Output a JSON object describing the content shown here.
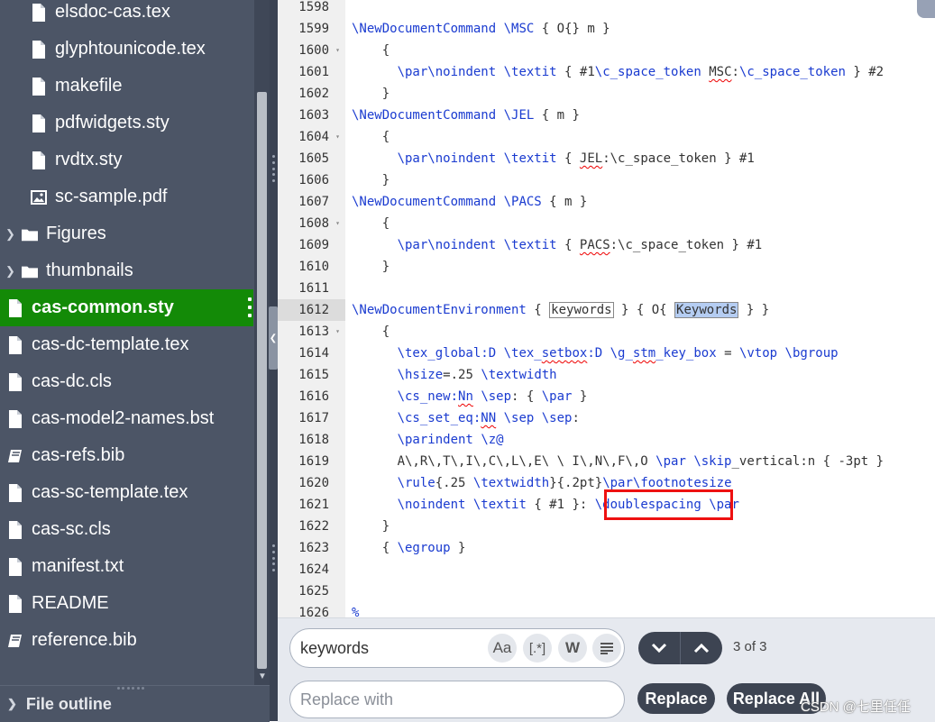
{
  "sidebar": {
    "items": [
      {
        "label": "elsdoc-cas.tex",
        "type": "file"
      },
      {
        "label": "glyphtounicode.tex",
        "type": "file"
      },
      {
        "label": "makefile",
        "type": "file"
      },
      {
        "label": "pdfwidgets.sty",
        "type": "file"
      },
      {
        "label": "rvdtx.sty",
        "type": "file"
      },
      {
        "label": "sc-sample.pdf",
        "type": "image"
      },
      {
        "label": "Figures",
        "type": "folder"
      },
      {
        "label": "thumbnails",
        "type": "folder"
      },
      {
        "label": "cas-common.sty",
        "type": "file",
        "active": true
      },
      {
        "label": "cas-dc-template.tex",
        "type": "file"
      },
      {
        "label": "cas-dc.cls",
        "type": "file"
      },
      {
        "label": "cas-model2-names.bst",
        "type": "file"
      },
      {
        "label": "cas-refs.bib",
        "type": "bib"
      },
      {
        "label": "cas-sc-template.tex",
        "type": "file"
      },
      {
        "label": "cas-sc.cls",
        "type": "file"
      },
      {
        "label": "manifest.txt",
        "type": "file"
      },
      {
        "label": "README",
        "type": "file"
      },
      {
        "label": "reference.bib",
        "type": "bib"
      }
    ],
    "file_outline_label": "File outline"
  },
  "editor": {
    "active_line": "1612",
    "lines": [
      {
        "n": "1598",
        "fold": false,
        "segs": []
      },
      {
        "n": "1599",
        "fold": false,
        "segs": [
          {
            "t": "\\NewDocumentCommand",
            "c": "kw"
          },
          {
            "t": " "
          },
          {
            "t": "\\MSC",
            "c": "kw"
          },
          {
            "t": " { O{} m }"
          }
        ]
      },
      {
        "n": "1600",
        "fold": true,
        "segs": [
          {
            "t": "    {"
          }
        ]
      },
      {
        "n": "1601",
        "fold": false,
        "segs": [
          {
            "t": "      "
          },
          {
            "t": "\\par",
            "c": "kw"
          },
          {
            "t": "\\noindent",
            "c": "kw"
          },
          {
            "t": " "
          },
          {
            "t": "\\textit",
            "c": "kw"
          },
          {
            "t": " { #1"
          },
          {
            "t": "\\c_space_token",
            "c": "kw"
          },
          {
            "t": " "
          },
          {
            "t": "MSC",
            "c": "sq"
          },
          {
            "t": ":"
          },
          {
            "t": "\\c_space_token",
            "c": "kw"
          },
          {
            "t": " } #2"
          }
        ]
      },
      {
        "n": "1602",
        "fold": false,
        "segs": [
          {
            "t": "    }"
          }
        ]
      },
      {
        "n": "1603",
        "fold": false,
        "segs": [
          {
            "t": "\\NewDocumentCommand",
            "c": "kw"
          },
          {
            "t": " "
          },
          {
            "t": "\\JEL",
            "c": "kw"
          },
          {
            "t": " { m }"
          }
        ]
      },
      {
        "n": "1604",
        "fold": true,
        "segs": [
          {
            "t": "    {"
          }
        ]
      },
      {
        "n": "1605",
        "fold": false,
        "segs": [
          {
            "t": "      "
          },
          {
            "t": "\\par",
            "c": "kw"
          },
          {
            "t": "\\noindent",
            "c": "kw"
          },
          {
            "t": " "
          },
          {
            "t": "\\textit",
            "c": "kw"
          },
          {
            "t": " { "
          },
          {
            "t": "JEL",
            "c": "sq"
          },
          {
            "t": ":\\c_space_token } #1"
          }
        ]
      },
      {
        "n": "1606",
        "fold": false,
        "segs": [
          {
            "t": "    }"
          }
        ]
      },
      {
        "n": "1607",
        "fold": false,
        "segs": [
          {
            "t": "\\NewDocumentCommand",
            "c": "kw"
          },
          {
            "t": " "
          },
          {
            "t": "\\PACS",
            "c": "kw"
          },
          {
            "t": " { m }"
          }
        ]
      },
      {
        "n": "1608",
        "fold": true,
        "segs": [
          {
            "t": "    {"
          }
        ]
      },
      {
        "n": "1609",
        "fold": false,
        "segs": [
          {
            "t": "      "
          },
          {
            "t": "\\par",
            "c": "kw"
          },
          {
            "t": "\\noindent",
            "c": "kw"
          },
          {
            "t": " "
          },
          {
            "t": "\\textit",
            "c": "kw"
          },
          {
            "t": " { "
          },
          {
            "t": "PACS",
            "c": "sq"
          },
          {
            "t": ":\\c_space_token } #1"
          }
        ]
      },
      {
        "n": "1610",
        "fold": false,
        "segs": [
          {
            "t": "    }"
          }
        ]
      },
      {
        "n": "1611",
        "fold": false,
        "segs": []
      },
      {
        "n": "1612",
        "fold": false,
        "segs": [
          {
            "t": "\\NewDocumentEnvironment",
            "c": "kw"
          },
          {
            "t": " { "
          },
          {
            "t": "keywords",
            "c": "box"
          },
          {
            "t": " } { O{ "
          },
          {
            "t": "Keywords",
            "c": "hl"
          },
          {
            "t": " } }"
          }
        ]
      },
      {
        "n": "1613",
        "fold": true,
        "segs": [
          {
            "t": "    {"
          }
        ]
      },
      {
        "n": "1614",
        "fold": false,
        "segs": [
          {
            "t": "      "
          },
          {
            "t": "\\tex_global:D",
            "c": "kw"
          },
          {
            "t": " "
          },
          {
            "t": "\\tex_",
            "c": "kw"
          },
          {
            "t": "setbox",
            "c": "kw sq"
          },
          {
            "t": ":D",
            "c": "kw"
          },
          {
            "t": " "
          },
          {
            "t": "\\g_",
            "c": "kw"
          },
          {
            "t": "stm",
            "c": "kw sq"
          },
          {
            "t": "_key_box",
            "c": "kw"
          },
          {
            "t": " = "
          },
          {
            "t": "\\vtop",
            "c": "kw"
          },
          {
            "t": " "
          },
          {
            "t": "\\bgroup",
            "c": "kw"
          }
        ]
      },
      {
        "n": "1615",
        "fold": false,
        "segs": [
          {
            "t": "      "
          },
          {
            "t": "\\hsize",
            "c": "kw"
          },
          {
            "t": "=.25 "
          },
          {
            "t": "\\textwidth",
            "c": "kw"
          }
        ]
      },
      {
        "n": "1616",
        "fold": false,
        "segs": [
          {
            "t": "      "
          },
          {
            "t": "\\cs_new:",
            "c": "kw"
          },
          {
            "t": "Nn",
            "c": "kw sq"
          },
          {
            "t": " "
          },
          {
            "t": "\\sep",
            "c": "kw"
          },
          {
            "t": ": { "
          },
          {
            "t": "\\par",
            "c": "kw"
          },
          {
            "t": " }"
          }
        ]
      },
      {
        "n": "1617",
        "fold": false,
        "segs": [
          {
            "t": "      "
          },
          {
            "t": "\\cs_set_eq:",
            "c": "kw"
          },
          {
            "t": "NN",
            "c": "kw sq"
          },
          {
            "t": " "
          },
          {
            "t": "\\sep",
            "c": "kw"
          },
          {
            "t": " "
          },
          {
            "t": "\\sep",
            "c": "kw"
          },
          {
            "t": ":"
          }
        ]
      },
      {
        "n": "1618",
        "fold": false,
        "segs": [
          {
            "t": "      "
          },
          {
            "t": "\\parindent",
            "c": "kw"
          },
          {
            "t": " "
          },
          {
            "t": "\\z@",
            "c": "kw"
          }
        ]
      },
      {
        "n": "1619",
        "fold": false,
        "segs": [
          {
            "t": "      A\\,R\\,T\\,I\\,C\\,L\\,E\\ \\ I\\,N\\,F\\,O "
          },
          {
            "t": "\\par",
            "c": "kw"
          },
          {
            "t": " "
          },
          {
            "t": "\\skip",
            "c": "kw"
          },
          {
            "t": "_vertical:n { -3pt }"
          }
        ]
      },
      {
        "n": "1620",
        "fold": false,
        "segs": [
          {
            "t": "      "
          },
          {
            "t": "\\rule",
            "c": "kw"
          },
          {
            "t": "{.25 "
          },
          {
            "t": "\\textwidth",
            "c": "kw"
          },
          {
            "t": "}{.2pt}"
          },
          {
            "t": "\\par",
            "c": "kw"
          },
          {
            "t": "\\footnotesize",
            "c": "kw"
          }
        ]
      },
      {
        "n": "1621",
        "fold": false,
        "segs": [
          {
            "t": "      "
          },
          {
            "t": "\\noindent",
            "c": "kw"
          },
          {
            "t": " "
          },
          {
            "t": "\\textit",
            "c": "kw"
          },
          {
            "t": " { #1 }: "
          },
          {
            "t": "\\doublespacing",
            "c": "kw"
          },
          {
            "t": " "
          },
          {
            "t": "\\par",
            "c": "kw"
          }
        ]
      },
      {
        "n": "1622",
        "fold": false,
        "segs": [
          {
            "t": "    }"
          }
        ]
      },
      {
        "n": "1623",
        "fold": false,
        "segs": [
          {
            "t": "    { "
          },
          {
            "t": "\\egroup",
            "c": "kw"
          },
          {
            "t": " }"
          }
        ]
      },
      {
        "n": "1624",
        "fold": false,
        "segs": []
      },
      {
        "n": "1625",
        "fold": false,
        "segs": []
      },
      {
        "n": "1626",
        "fold": false,
        "segs": [
          {
            "t": "%",
            "c": "kw"
          }
        ]
      }
    ]
  },
  "search": {
    "value": "keywords",
    "options": {
      "match_case": "Aa",
      "regex": "[.*]",
      "whole_word": "W"
    },
    "match_count": "3 of 3"
  },
  "replace": {
    "placeholder": "Replace with",
    "replace_label": "Replace",
    "replace_all_label": "Replace All"
  },
  "watermark": "CSDN @七里任任",
  "colors": {
    "active_file": "#138a07",
    "highlight": "#e11111",
    "keyword": "#1a3bd0"
  }
}
